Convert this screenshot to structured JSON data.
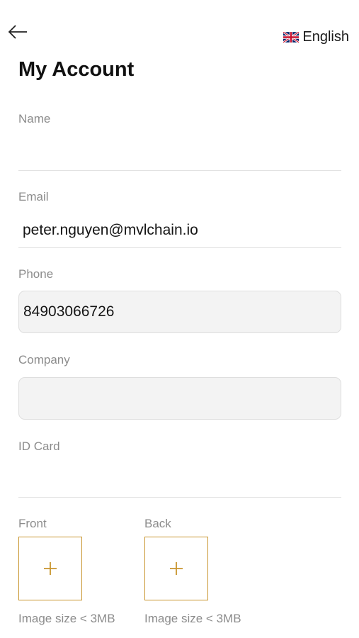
{
  "header": {
    "back_icon": "arrow-left-icon",
    "language": {
      "label": "English",
      "flag_icon": "uk-flag-icon"
    },
    "title": "My Account"
  },
  "form": {
    "name": {
      "label": "Name",
      "value": ""
    },
    "email": {
      "label": "Email",
      "value": "peter.nguyen@mvlchain.io"
    },
    "phone": {
      "label": "Phone",
      "value": "84903066726"
    },
    "company": {
      "label": "Company",
      "value": ""
    },
    "id_card": {
      "label": "ID Card",
      "value": ""
    }
  },
  "uploads": {
    "front": {
      "label": "Front",
      "hint": "Image size < 3MB",
      "icon": "plus-icon"
    },
    "back": {
      "label": "Back",
      "hint": "Image size < 3MB",
      "icon": "plus-icon"
    }
  },
  "colors": {
    "accent": "#c8952e",
    "label": "#8c8c8c",
    "field_bg": "#f3f3f3"
  }
}
